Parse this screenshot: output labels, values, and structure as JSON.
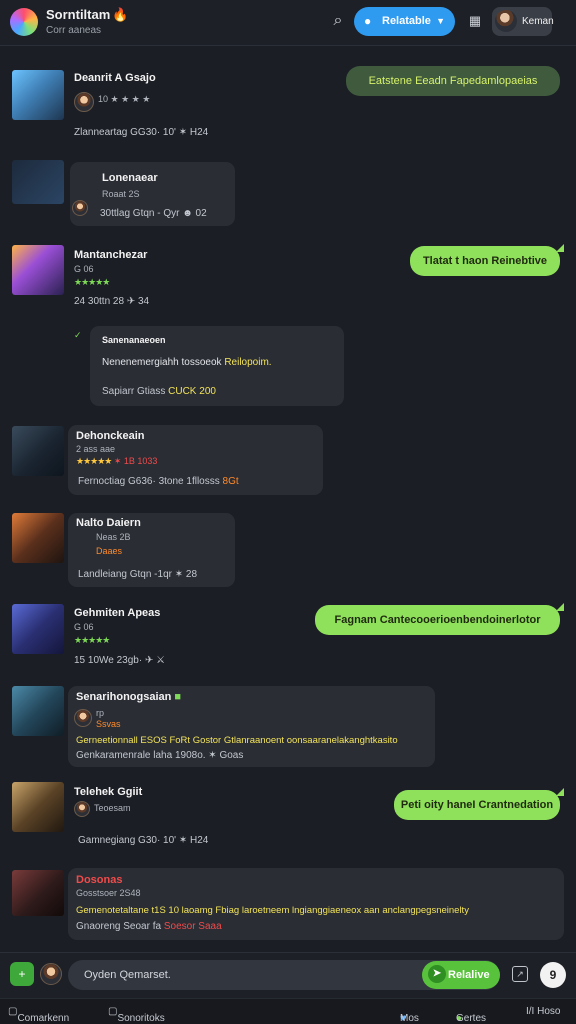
{
  "header": {
    "title": "Sorntiltam",
    "subtitle": "Corr aaneas",
    "primary_button": "Relatable",
    "user_label": "Keman"
  },
  "entries": [
    {
      "name": "Deanrit A Gsajo",
      "meta": "10 ★ ★ ★ ★",
      "stats": "Zlanneartag  GG30·  10'  ✶ H24"
    },
    {
      "name": "Lonenaear",
      "meta": "Roaat 2S",
      "stats": "30ttlag  Gtqn - Qyr  ☻ 02"
    },
    {
      "name": "Mantanchezar",
      "meta": "G  06",
      "rating": "★★★★★",
      "stats": "24  30ttn  28  ✈  34"
    },
    {
      "name": "Sanenanaeoen",
      "meta": "Nenenemergiahh tossoeok",
      "highlight": "Reilopoim.",
      "stats": "Sapiarr  Gtiass",
      "tag": "CUCK",
      "stats2": "200"
    },
    {
      "name": "Dehonckeain",
      "meta": "2 ass aae",
      "rating": "★★★★★",
      "rating2": "✶ 1B 1033",
      "stats": "Fernoctiag  G636·  3tone  1fllosss",
      "end": "8Gt"
    },
    {
      "name": "Nalto Daiern",
      "meta": "Neas 2B",
      "sub": "Daaes",
      "stats": "Landleiang  Gtqn  -1qr  ✶ 28"
    },
    {
      "name": "Gehmiten Apeas",
      "meta": "G  06",
      "rating": "★★★★★",
      "stats": "15  10We  23gb·  ✈  ⚔"
    },
    {
      "name": "Senarihonogsaian",
      "meta": "rp",
      "sub": "Ssvas",
      "line1": "Gerneetionnall ESOS FoRt Gostor Gtlanraanoent oonsaaranelakanghtkasito",
      "line2": "Genkaramenrale  laha  1908o.  ✶  Goas"
    },
    {
      "name": "Telehek Ggiit",
      "meta": "Teoesam",
      "stats": "Gamnegiang  G30·  10'  ✶ H24"
    },
    {
      "name": "Dosonas",
      "meta": "Gosstsoer 2S48",
      "line1": "Gemenotetaltane t1S 10 laoamg Fbiag laroetneem lngianggiaeneox aan anclangpegsneinelty",
      "line2": "Gnaoreng  Seoar  fa",
      "tag": "Soesor Saaa"
    }
  ],
  "bubbles": [
    "Eatstene  Eeadn  Fapedamlopaeias",
    "Tlatat  t  haon  Reinebtive",
    "Fagnam  Cantecooerioenbendoinerlotor",
    "Peti oity haneI Crantnedation"
  ],
  "composer": {
    "placeholder": "Oyden Qemarset.",
    "send": "Relalive"
  },
  "bottom_nav": [
    "Comarkenn",
    "Sonoritoks",
    "Mos",
    "Gertes",
    "I/I Hoso"
  ],
  "colors": {
    "background": "#1b1e24",
    "accent_blue": "#2f9bf0",
    "accent_green": "#8fe05a",
    "send_green": "#58c23c"
  }
}
